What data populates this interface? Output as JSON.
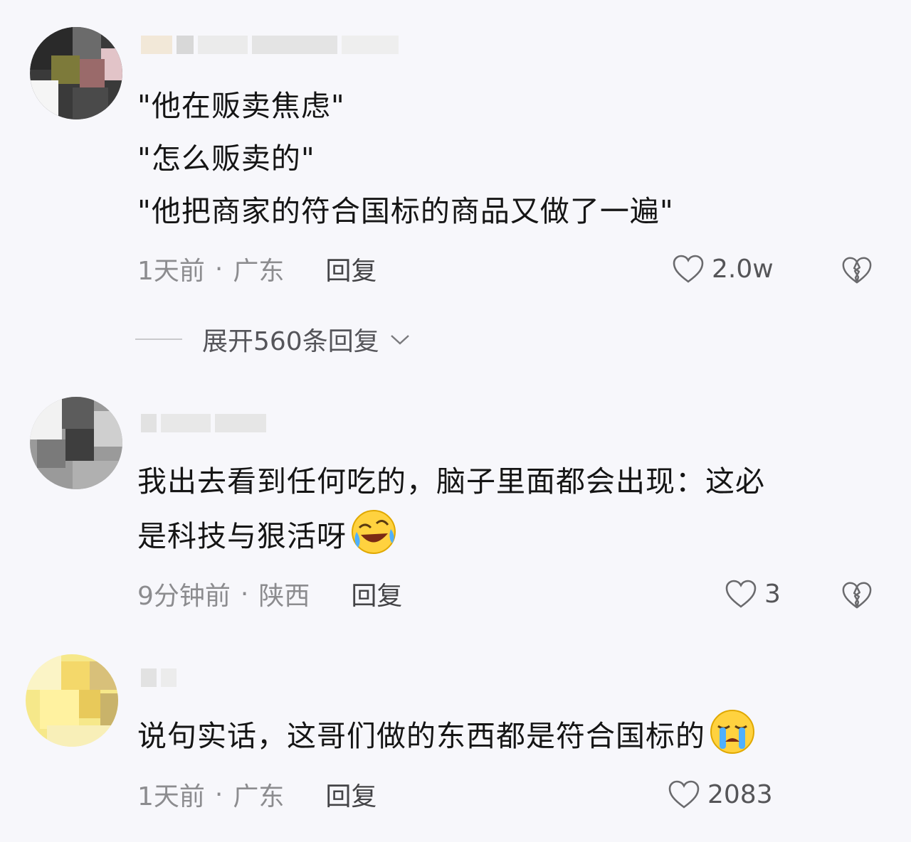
{
  "comments": [
    {
      "lines": [
        "\"他在贩卖焦虑\"",
        "\"怎么贩卖的\"",
        "\"他把商家的符合国标的商品又做了一遍\""
      ],
      "time": "1天前",
      "location": "广东",
      "reply_label": "回复",
      "likes": "2.0w",
      "expand_label": "展开560条回复"
    },
    {
      "lines": [
        "我出去看到任何吃的，脑子里面都会出现：这必",
        "是科技与狠活呀"
      ],
      "emoji": "laughing-crying-emoji",
      "time": "9分钟前",
      "location": "陕西",
      "reply_label": "回复",
      "likes": "3"
    },
    {
      "lines": [
        "说句实话，这哥们做的东西都是符合国标的"
      ],
      "emoji": "crying-emoji",
      "time": "1天前",
      "location": "广东",
      "reply_label": "回复",
      "likes": "2083"
    }
  ],
  "separator": "·",
  "icons": [
    "heart-icon",
    "broken-heart-icon",
    "chevron-down-icon"
  ]
}
